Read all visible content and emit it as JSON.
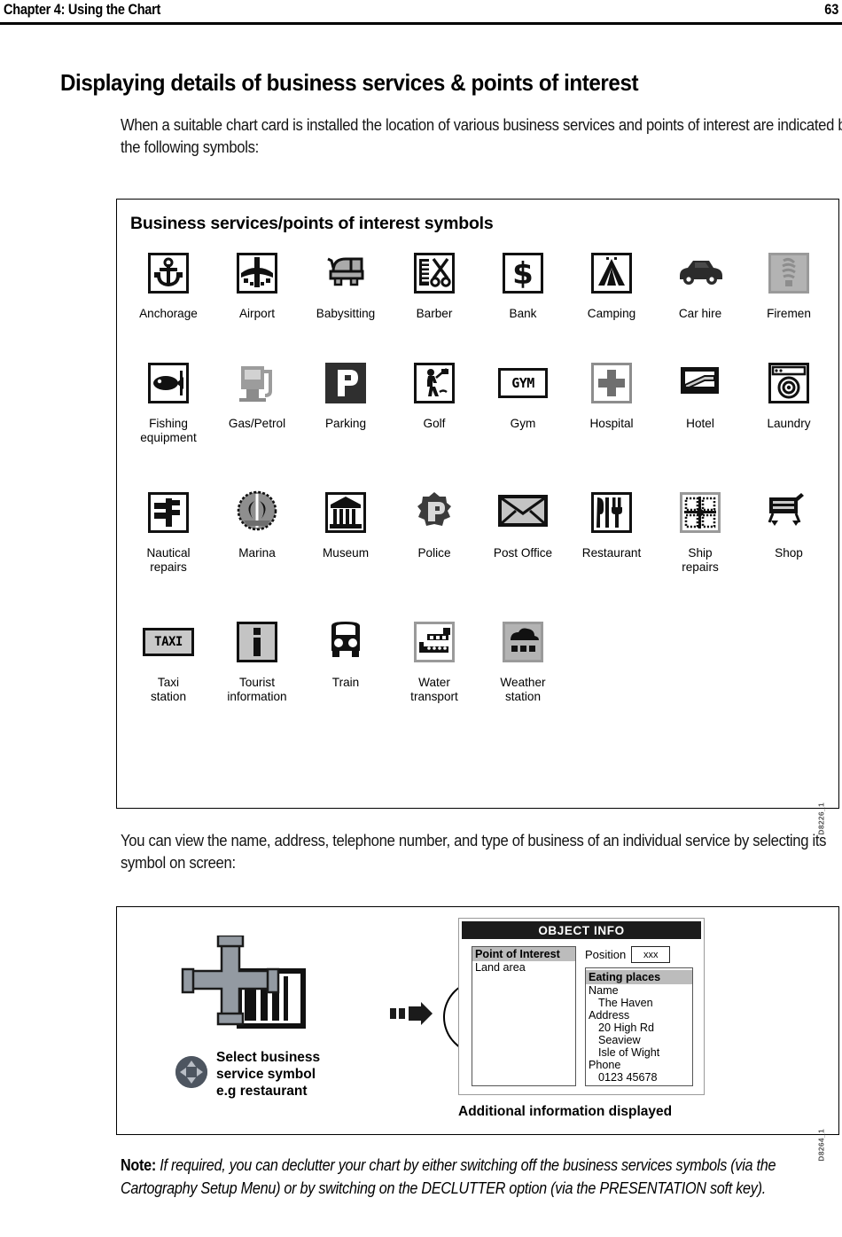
{
  "header": {
    "chapter": "Chapter 4: Using the Chart",
    "page_number": "63"
  },
  "heading": "Displaying details of business services & points of interest",
  "intro_paragraph": "When a suitable chart card is installed the location of various business services and points of interest are indicated by the following symbols:",
  "mid_paragraph": "You can view the name, address, telephone number, and type of business of an individual service by selecting its symbol on screen:",
  "note": {
    "label": "Note:",
    "text": "If required, you can declutter your chart by either switching off the business services symbols (via the Cartography Setup Menu) or by switching on the DECLUTTER option (via the PRESENTATION soft key)."
  },
  "figure_symbols": {
    "title": "Business services/points of interest symbols",
    "figure_id": "D8226_1",
    "rows": [
      [
        {
          "label": "Anchorage",
          "icon": "anchor-icon"
        },
        {
          "label": "Airport",
          "icon": "airport-icon"
        },
        {
          "label": "Babysitting",
          "icon": "pram-icon"
        },
        {
          "label": "Barber",
          "icon": "scissors-comb-icon"
        },
        {
          "label": "Bank",
          "icon": "dollar-icon"
        },
        {
          "label": "Camping",
          "icon": "tent-icon"
        },
        {
          "label": "Car hire",
          "icon": "car-icon"
        },
        {
          "label": "Firemen",
          "icon": "fire-hydrant-icon"
        }
      ],
      [
        {
          "label": "Fishing\nequipment",
          "icon": "fish-icon"
        },
        {
          "label": "Gas/Petrol",
          "icon": "fuel-pump-icon"
        },
        {
          "label": "Parking",
          "icon": "parking-p-icon"
        },
        {
          "label": "Golf",
          "icon": "golfer-icon"
        },
        {
          "label": "Gym",
          "icon": "gym-text-icon"
        },
        {
          "label": "Hospital",
          "icon": "cross-icon"
        },
        {
          "label": "Hotel",
          "icon": "bed-icon"
        },
        {
          "label": "Laundry",
          "icon": "washing-machine-icon"
        }
      ],
      [
        {
          "label": "Nautical\nrepairs",
          "icon": "wrench-icon"
        },
        {
          "label": "Marina",
          "icon": "marina-icon"
        },
        {
          "label": "Museum",
          "icon": "museum-icon"
        },
        {
          "label": "Police",
          "icon": "police-badge-icon"
        },
        {
          "label": "Post Office",
          "icon": "envelope-icon"
        },
        {
          "label": "Restaurant",
          "icon": "cutlery-icon"
        },
        {
          "label": "Ship\nrepairs",
          "icon": "ship-repairs-icon"
        },
        {
          "label": "Shop",
          "icon": "shopping-cart-icon"
        }
      ],
      [
        {
          "label": "Taxi\nstation",
          "icon": "taxi-text-icon"
        },
        {
          "label": "Tourist\ninformation",
          "icon": "information-i-icon"
        },
        {
          "label": "Train",
          "icon": "train-icon"
        },
        {
          "label": "Water\ntransport",
          "icon": "ferry-icon"
        },
        {
          "label": "Weather\nstation",
          "icon": "weather-icon"
        }
      ]
    ]
  },
  "figure_workflow": {
    "figure_id": "D8264_1",
    "ok_button": "OK",
    "trackpad_note": "Select business\nservice symbol\ne.g restaurant",
    "caption": "Additional information displayed",
    "object_info": {
      "title": "OBJECT INFO",
      "left_list": [
        {
          "text": "Point of Interest",
          "selected": true
        },
        {
          "text": "Land area",
          "selected": false
        }
      ],
      "position_label": "Position",
      "position_value": "xxx",
      "detail_list": [
        {
          "text": "Eating places",
          "selected": true,
          "indent": false
        },
        {
          "text": "Name",
          "selected": false,
          "indent": false
        },
        {
          "text": "The Haven",
          "selected": false,
          "indent": true
        },
        {
          "text": "Address",
          "selected": false,
          "indent": false
        },
        {
          "text": "20 High Rd",
          "selected": false,
          "indent": true
        },
        {
          "text": "Seaview",
          "selected": false,
          "indent": true
        },
        {
          "text": "Isle of Wight",
          "selected": false,
          "indent": true
        },
        {
          "text": "Phone",
          "selected": false,
          "indent": false
        },
        {
          "text": "0123 45678",
          "selected": false,
          "indent": true
        }
      ]
    }
  }
}
